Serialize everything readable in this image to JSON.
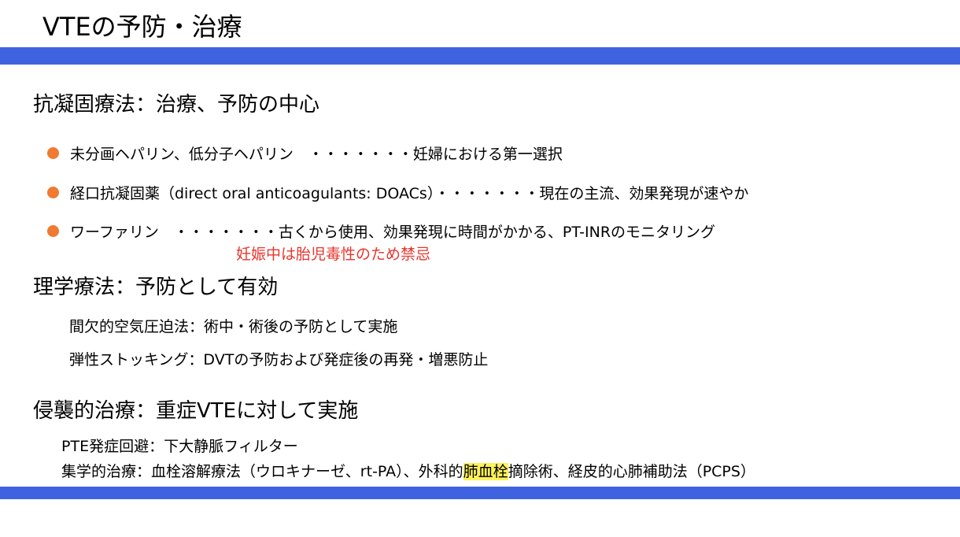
{
  "title": "VTEの予防・治療",
  "colors": {
    "band": "#3f63e0",
    "bullet": "#ef7a31",
    "warning": "#e8362d",
    "highlight": "#fff25a"
  },
  "sections": {
    "anticoag": {
      "heading": "抗凝固療法：治療、予防の中心",
      "items": [
        {
          "text": "未分画ヘパリン、低分子ヘパリン　・・・・・・・妊婦における第一選択"
        },
        {
          "text": "経口抗凝固薬（direct oral anticoagulants: DOACs）・・・・・・・現在の主流、効果発現が速やか"
        },
        {
          "text": "ワーファリン　・・・・・・・古くから使用、効果発現に時間がかかる、PT-INRのモニタリング",
          "warning": "妊娠中は胎児毒性のため禁忌"
        }
      ]
    },
    "physical": {
      "heading": "理学療法：予防として有効",
      "items": [
        "間欠的空気圧迫法：術中・術後の予防として実施",
        "弾性ストッキング：DVTの予防および発症後の再発・増悪防止"
      ]
    },
    "invasive": {
      "heading": "侵襲的治療：重症VTEに対して実施",
      "items": [
        {
          "text": "PTE発症回避：下大静脈フィルター"
        },
        {
          "before": "集学的治療：血栓溶解療法（ウロキナーゼ、rt-PA）、外科的",
          "highlight": "肺血栓",
          "after": "摘除術、経皮的心肺補助法（PCPS）"
        }
      ]
    }
  }
}
